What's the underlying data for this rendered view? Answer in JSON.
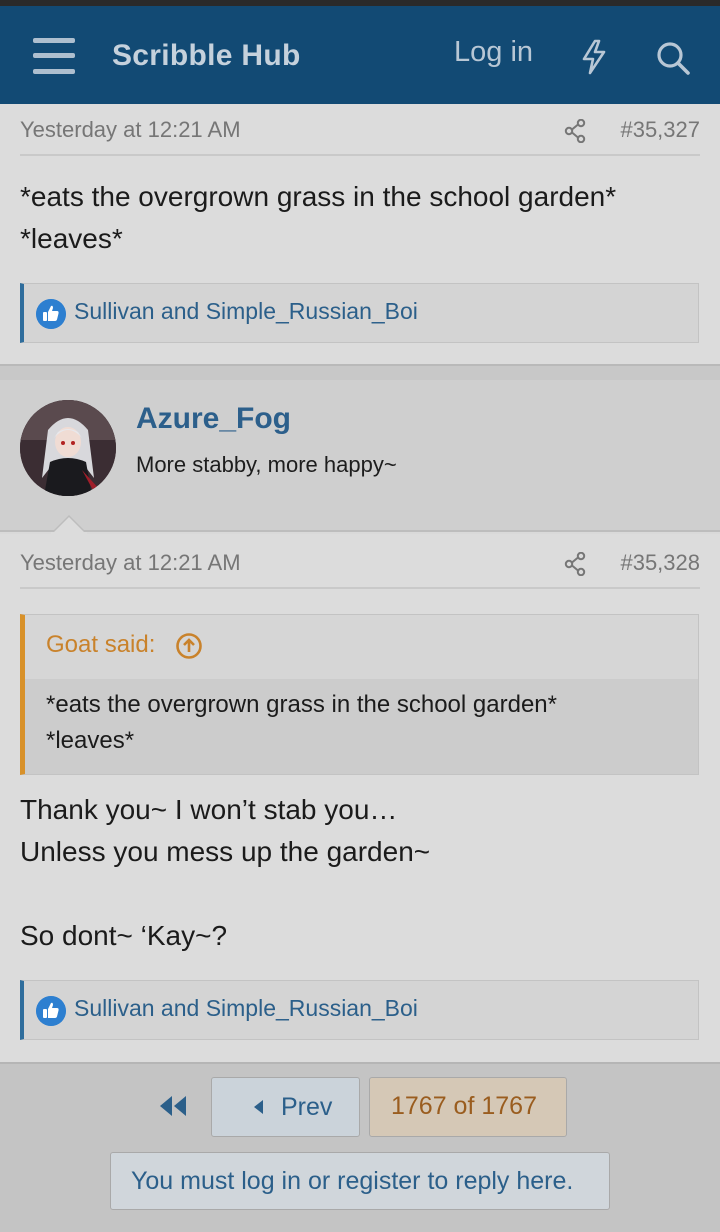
{
  "app": {
    "brand": "Scribble Hub",
    "login_label": "Log in"
  },
  "posts": [
    {
      "date": "Yesterday at 12:21 AM",
      "number": "#35,327",
      "lines": [
        "*eats the overgrown grass in the school garden*",
        "*leaves*"
      ],
      "reactions": "Sullivan and Simple_Russian_Boi"
    },
    {
      "author": "Azure_Fog",
      "user_title": "More stabby, more happy~",
      "date": "Yesterday at 12:21 AM",
      "number": "#35,328",
      "quote": {
        "author": "Goat said:",
        "lines": [
          "*eats the overgrown grass in the school garden*",
          "*leaves*"
        ]
      },
      "lines": [
        "Thank you~ I won’t stab you…",
        "Unless you mess up the garden~",
        "",
        "So dont~ ‘Kay~?"
      ],
      "reactions": "Sullivan and Simple_Russian_Boi"
    }
  ],
  "pagination": {
    "prev_label": "Prev",
    "page_label": "1767 of 1767"
  },
  "reply_notice": "You must log in or register to reply here.",
  "icons": [
    "menu-icon",
    "bolt-icon",
    "search-icon",
    "share-icon",
    "like-icon",
    "quote-arrow-icon",
    "first-page-icon",
    "prev-arrow-icon"
  ],
  "colors": {
    "header": "#124a74",
    "link": "#2c5f8b",
    "quote_accent": "#d8912a",
    "like": "#2d7fd0"
  }
}
